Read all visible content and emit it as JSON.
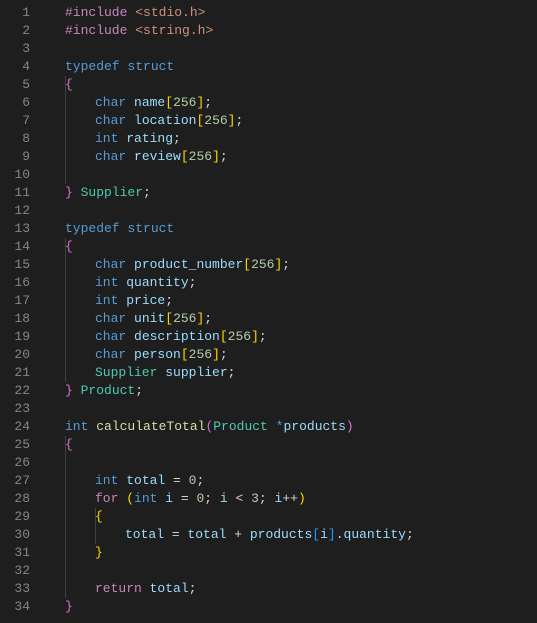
{
  "chart_data": null,
  "editor": {
    "language": "c",
    "lines": [
      {
        "n": 1,
        "tokens": [
          [
            "mac",
            "#include"
          ],
          [
            "pun",
            " "
          ],
          [
            "str",
            "<stdio.h>"
          ]
        ]
      },
      {
        "n": 2,
        "tokens": [
          [
            "mac",
            "#include"
          ],
          [
            "pun",
            " "
          ],
          [
            "str",
            "<string.h>"
          ]
        ]
      },
      {
        "n": 3,
        "tokens": []
      },
      {
        "n": 4,
        "tokens": [
          [
            "kw",
            "typedef"
          ],
          [
            "pun",
            " "
          ],
          [
            "kw",
            "struct"
          ]
        ]
      },
      {
        "n": 5,
        "tokens": [
          [
            "brk",
            "{"
          ]
        ],
        "guides": [
          1
        ]
      },
      {
        "n": 6,
        "indent": 1,
        "tokens": [
          [
            "kw",
            "char"
          ],
          [
            "pun",
            " "
          ],
          [
            "var",
            "name"
          ],
          [
            "bry",
            "["
          ],
          [
            "num",
            "256"
          ],
          [
            "bry",
            "]"
          ],
          [
            "pun",
            ";"
          ]
        ],
        "guides": [
          1
        ]
      },
      {
        "n": 7,
        "indent": 1,
        "tokens": [
          [
            "kw",
            "char"
          ],
          [
            "pun",
            " "
          ],
          [
            "var",
            "location"
          ],
          [
            "bry",
            "["
          ],
          [
            "num",
            "256"
          ],
          [
            "bry",
            "]"
          ],
          [
            "pun",
            ";"
          ]
        ],
        "guides": [
          1
        ]
      },
      {
        "n": 8,
        "indent": 1,
        "tokens": [
          [
            "kw",
            "int"
          ],
          [
            "pun",
            " "
          ],
          [
            "var",
            "rating"
          ],
          [
            "pun",
            ";"
          ]
        ],
        "guides": [
          1
        ]
      },
      {
        "n": 9,
        "indent": 1,
        "tokens": [
          [
            "kw",
            "char"
          ],
          [
            "pun",
            " "
          ],
          [
            "var",
            "review"
          ],
          [
            "bry",
            "["
          ],
          [
            "num",
            "256"
          ],
          [
            "bry",
            "]"
          ],
          [
            "pun",
            ";"
          ]
        ],
        "guides": [
          1
        ]
      },
      {
        "n": 10,
        "tokens": [],
        "guides": [
          1
        ]
      },
      {
        "n": 11,
        "tokens": [
          [
            "brk",
            "}"
          ],
          [
            "pun",
            " "
          ],
          [
            "type",
            "Supplier"
          ],
          [
            "pun",
            ";"
          ]
        ]
      },
      {
        "n": 12,
        "tokens": []
      },
      {
        "n": 13,
        "tokens": [
          [
            "kw",
            "typedef"
          ],
          [
            "pun",
            " "
          ],
          [
            "kw",
            "struct"
          ]
        ]
      },
      {
        "n": 14,
        "tokens": [
          [
            "brk",
            "{"
          ]
        ],
        "guides": [
          1
        ]
      },
      {
        "n": 15,
        "indent": 1,
        "tokens": [
          [
            "kw",
            "char"
          ],
          [
            "pun",
            " "
          ],
          [
            "var",
            "product_number"
          ],
          [
            "bry",
            "["
          ],
          [
            "num",
            "256"
          ],
          [
            "bry",
            "]"
          ],
          [
            "pun",
            ";"
          ]
        ],
        "guides": [
          1
        ]
      },
      {
        "n": 16,
        "indent": 1,
        "tokens": [
          [
            "kw",
            "int"
          ],
          [
            "pun",
            " "
          ],
          [
            "var",
            "quantity"
          ],
          [
            "pun",
            ";"
          ]
        ],
        "guides": [
          1
        ]
      },
      {
        "n": 17,
        "indent": 1,
        "tokens": [
          [
            "kw",
            "int"
          ],
          [
            "pun",
            " "
          ],
          [
            "var",
            "price"
          ],
          [
            "pun",
            ";"
          ]
        ],
        "guides": [
          1
        ]
      },
      {
        "n": 18,
        "indent": 1,
        "tokens": [
          [
            "kw",
            "char"
          ],
          [
            "pun",
            " "
          ],
          [
            "var",
            "unit"
          ],
          [
            "bry",
            "["
          ],
          [
            "num",
            "256"
          ],
          [
            "bry",
            "]"
          ],
          [
            "pun",
            ";"
          ]
        ],
        "guides": [
          1
        ]
      },
      {
        "n": 19,
        "indent": 1,
        "tokens": [
          [
            "kw",
            "char"
          ],
          [
            "pun",
            " "
          ],
          [
            "var",
            "description"
          ],
          [
            "bry",
            "["
          ],
          [
            "num",
            "256"
          ],
          [
            "bry",
            "]"
          ],
          [
            "pun",
            ";"
          ]
        ],
        "guides": [
          1
        ]
      },
      {
        "n": 20,
        "indent": 1,
        "tokens": [
          [
            "kw",
            "char"
          ],
          [
            "pun",
            " "
          ],
          [
            "var",
            "person"
          ],
          [
            "bry",
            "["
          ],
          [
            "num",
            "256"
          ],
          [
            "bry",
            "]"
          ],
          [
            "pun",
            ";"
          ]
        ],
        "guides": [
          1
        ]
      },
      {
        "n": 21,
        "indent": 1,
        "tokens": [
          [
            "type",
            "Supplier"
          ],
          [
            "pun",
            " "
          ],
          [
            "var",
            "supplier"
          ],
          [
            "pun",
            ";"
          ]
        ],
        "guides": [
          1
        ]
      },
      {
        "n": 22,
        "tokens": [
          [
            "brk",
            "}"
          ],
          [
            "pun",
            " "
          ],
          [
            "type",
            "Product"
          ],
          [
            "pun",
            ";"
          ]
        ]
      },
      {
        "n": 23,
        "tokens": []
      },
      {
        "n": 24,
        "tokens": [
          [
            "kw",
            "int"
          ],
          [
            "pun",
            " "
          ],
          [
            "fn",
            "calculateTotal"
          ],
          [
            "brk",
            "("
          ],
          [
            "type",
            "Product"
          ],
          [
            "pun",
            " "
          ],
          [
            "kw",
            "*"
          ],
          [
            "var",
            "products"
          ],
          [
            "brk",
            ")"
          ]
        ]
      },
      {
        "n": 25,
        "tokens": [
          [
            "brk",
            "{"
          ]
        ],
        "guides": [
          1
        ]
      },
      {
        "n": 26,
        "indent": 1,
        "tokens": [],
        "guides": [
          1
        ]
      },
      {
        "n": 27,
        "indent": 1,
        "tokens": [
          [
            "kw",
            "int"
          ],
          [
            "pun",
            " "
          ],
          [
            "var",
            "total"
          ],
          [
            "pun",
            " = "
          ],
          [
            "num",
            "0"
          ],
          [
            "pun",
            ";"
          ]
        ],
        "guides": [
          1
        ]
      },
      {
        "n": 28,
        "indent": 1,
        "tokens": [
          [
            "mac",
            "for"
          ],
          [
            "pun",
            " "
          ],
          [
            "bry",
            "("
          ],
          [
            "kw",
            "int"
          ],
          [
            "pun",
            " "
          ],
          [
            "var",
            "i"
          ],
          [
            "pun",
            " = "
          ],
          [
            "num",
            "0"
          ],
          [
            "pun",
            "; "
          ],
          [
            "var",
            "i"
          ],
          [
            "pun",
            " < "
          ],
          [
            "num",
            "3"
          ],
          [
            "pun",
            "; "
          ],
          [
            "var",
            "i"
          ],
          [
            "pun",
            "++"
          ],
          [
            "bry",
            ")"
          ]
        ],
        "guides": [
          1
        ]
      },
      {
        "n": 29,
        "indent": 1,
        "tokens": [
          [
            "bry",
            "{"
          ]
        ],
        "guides": [
          1,
          2
        ]
      },
      {
        "n": 30,
        "indent": 2,
        "tokens": [
          [
            "var",
            "total"
          ],
          [
            "pun",
            " = "
          ],
          [
            "var",
            "total"
          ],
          [
            "pun",
            " + "
          ],
          [
            "var",
            "products"
          ],
          [
            "br2",
            "["
          ],
          [
            "var",
            "i"
          ],
          [
            "br2",
            "]"
          ],
          [
            "pun",
            "."
          ],
          [
            "var",
            "quantity"
          ],
          [
            "pun",
            ";"
          ]
        ],
        "guides": [
          1,
          2
        ]
      },
      {
        "n": 31,
        "indent": 1,
        "tokens": [
          [
            "bry",
            "}"
          ]
        ],
        "guides": [
          1
        ]
      },
      {
        "n": 32,
        "indent": 1,
        "tokens": [],
        "guides": [
          1
        ]
      },
      {
        "n": 33,
        "indent": 1,
        "tokens": [
          [
            "mac",
            "return"
          ],
          [
            "pun",
            " "
          ],
          [
            "var",
            "total"
          ],
          [
            "pun",
            ";"
          ]
        ],
        "guides": [
          1
        ]
      },
      {
        "n": 34,
        "tokens": [
          [
            "brk",
            "}"
          ]
        ]
      }
    ]
  }
}
